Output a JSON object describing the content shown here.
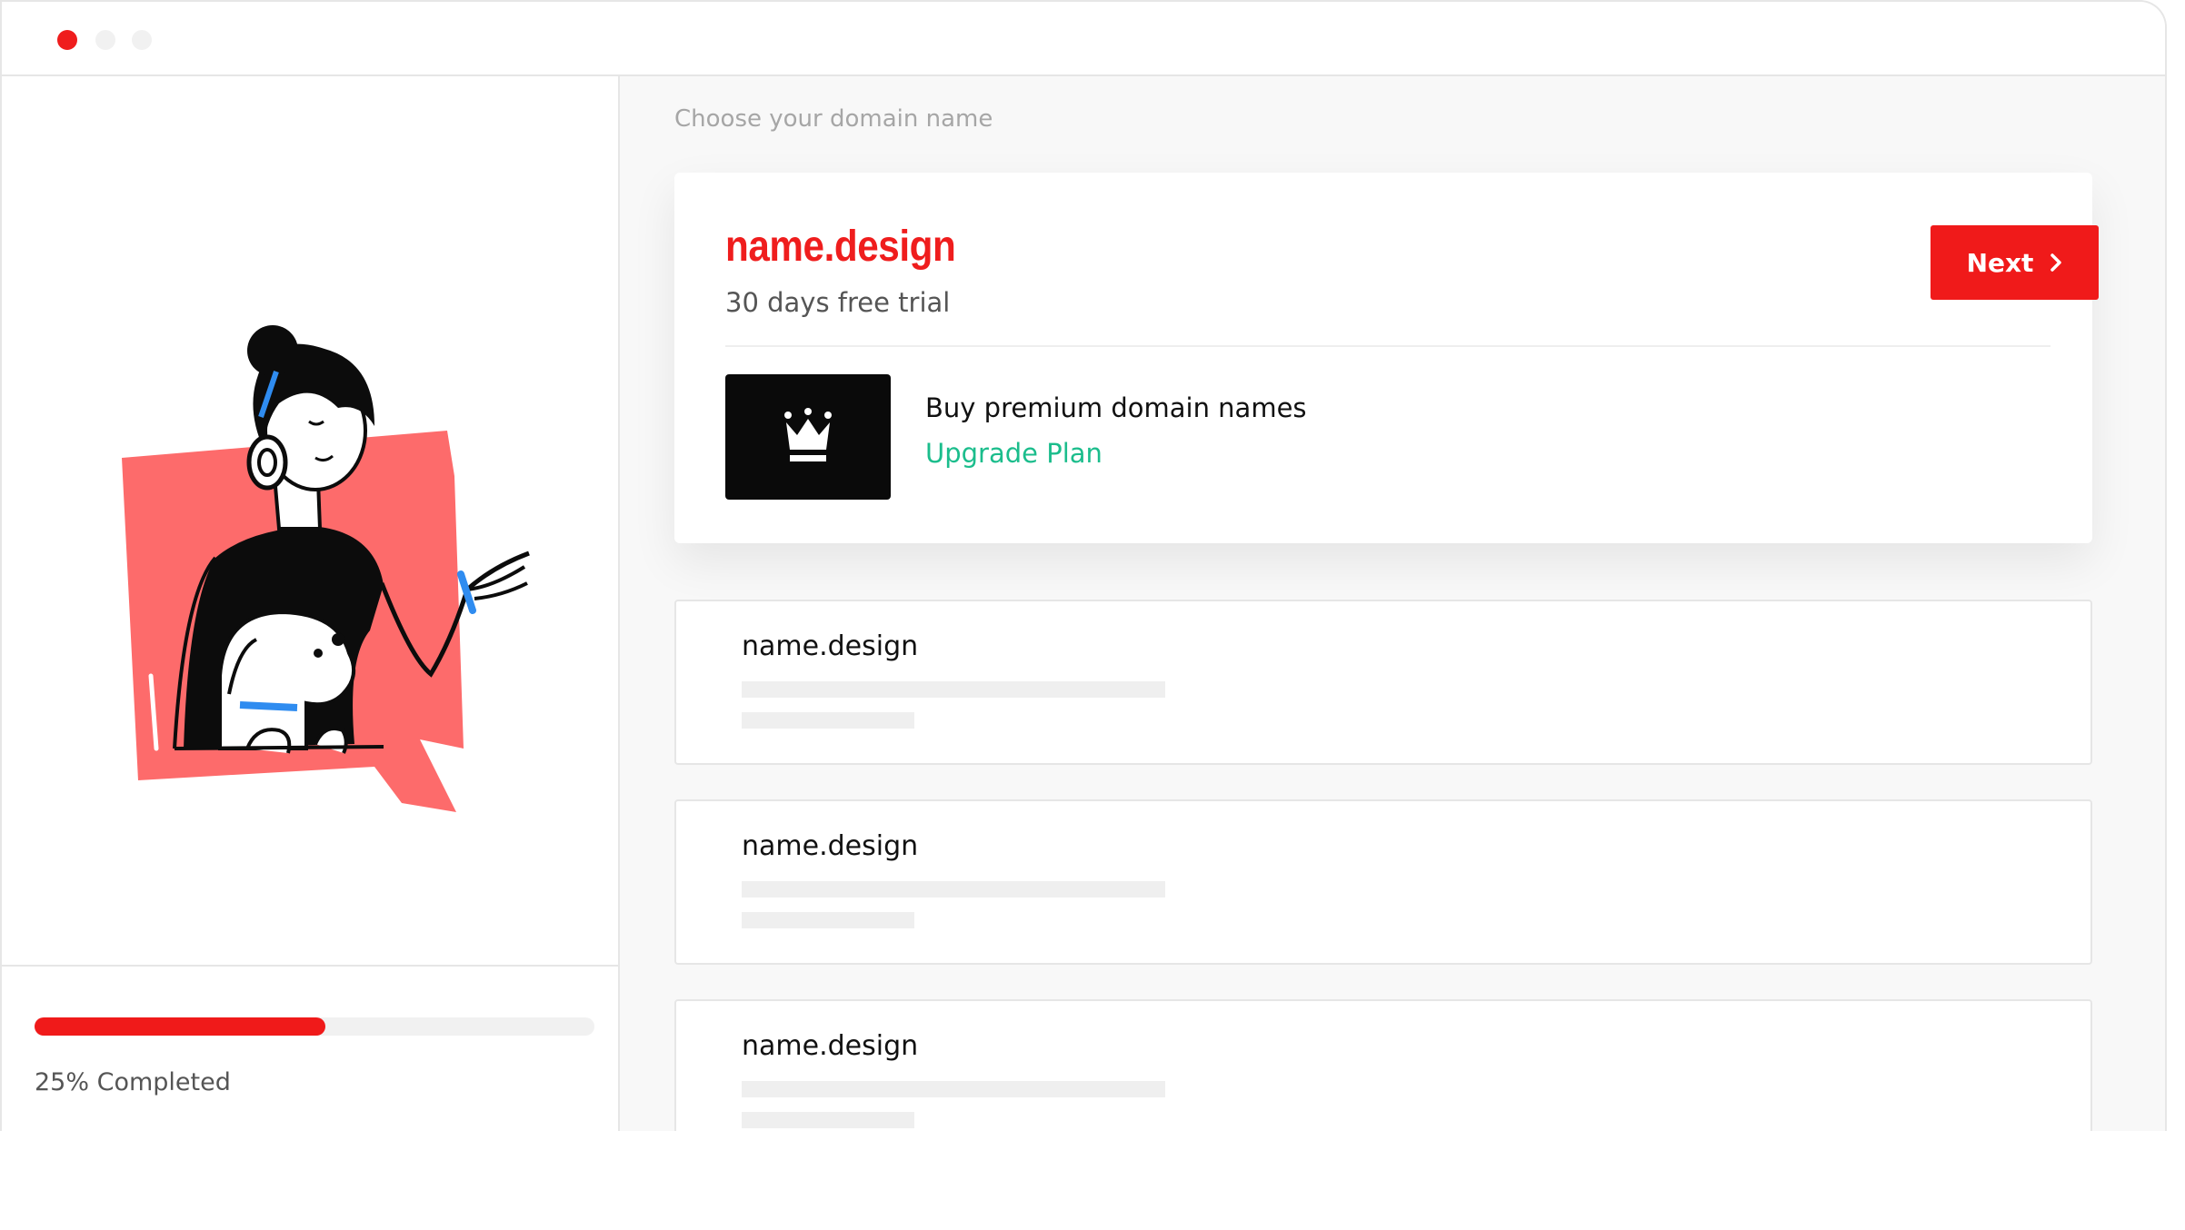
{
  "window": {
    "controls": [
      "close",
      "minimize",
      "maximize"
    ],
    "control_colors": {
      "close": "#ef1d1d",
      "inactive": "#f1f1f1"
    }
  },
  "sidebar": {
    "illustration": "woman-with-headphones-and-dog-illustration",
    "progress": {
      "percent": 25,
      "label": "25% Completed",
      "color": "#f01a1a"
    }
  },
  "main": {
    "section_title": "Choose your domain name",
    "featured": {
      "domain": "name.design",
      "subtitle": "30 days free trial",
      "next_button": "Next",
      "premium_icon": "crown-icon",
      "premium_text": "Buy premium domain names",
      "upgrade_link": "Upgrade Plan"
    },
    "domain_list": [
      {
        "name": "name.design"
      },
      {
        "name": "name.design"
      },
      {
        "name": "name.design"
      }
    ]
  },
  "colors": {
    "accent": "#ef1d1d",
    "link": "#1bbd8c",
    "muted_text": "#a6a6a6"
  }
}
